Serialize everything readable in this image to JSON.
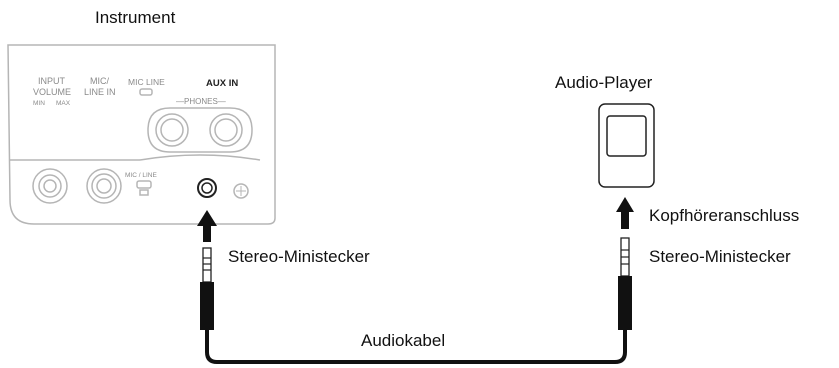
{
  "labels": {
    "instrument": "Instrument",
    "audio_player": "Audio-Player",
    "headphone_jack": "Kopfhöreranschluss",
    "plug_left": "Stereo-Ministecker",
    "plug_right": "Stereo-Ministecker",
    "cable": "Audiokabel"
  },
  "panel": {
    "input_volume_1": "INPUT",
    "input_volume_2": "VOLUME",
    "min": "MIN",
    "max": "MAX",
    "mic_line_in_1": "MIC/",
    "mic_line_in_2": "LINE IN",
    "mic_line_switch": "MIC  LINE",
    "aux_in": "AUX IN",
    "phones": "—PHONES—",
    "mic_line_small": "MIC / LINE"
  }
}
